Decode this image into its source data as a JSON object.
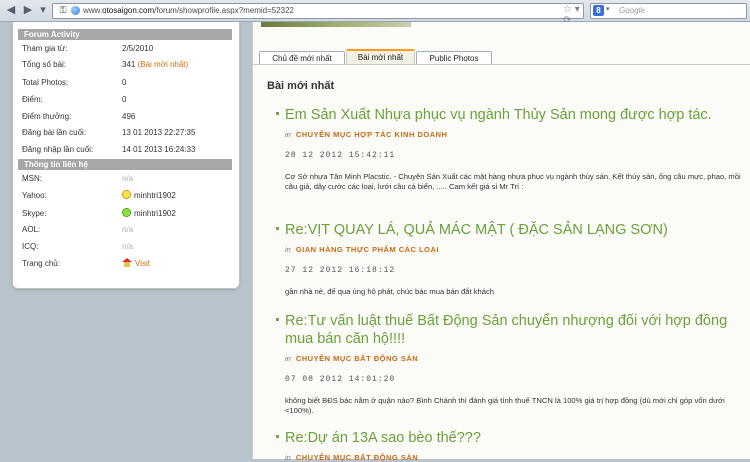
{
  "browser": {
    "url_prefix": "www.",
    "url_domain": "otosaigon.com",
    "url_path": "/forum/showprofile.aspx?memid=52322",
    "search_placeholder": "Google",
    "search_engine_letter": "8"
  },
  "sidebar": {
    "activity_header": "Forum Activity",
    "activity_rows": [
      {
        "label": "Tham gia từ:",
        "value": "2/5/2010"
      },
      {
        "label": "Tổng số bài:",
        "value": "341",
        "link": "(Bài mới nhất)"
      },
      {
        "label": "Total Photos:",
        "value": "0"
      },
      {
        "label": "Điểm:",
        "value": "0"
      },
      {
        "label": "Điểm thưởng:",
        "value": "496"
      },
      {
        "label": "Đăng bài lần cuối:",
        "value": "13 01 2013 22:27:35"
      },
      {
        "label": "Đăng nhập lần cuối:",
        "value": "14 01 2013 16:24:33"
      }
    ],
    "contact_header": "Thông tin liên hệ",
    "contact_rows": [
      {
        "label": "MSN:",
        "value": "n/a"
      },
      {
        "label": "Yahoo:",
        "value": "minhtri1902"
      },
      {
        "label": "Skype:",
        "value": "minhtri1902"
      },
      {
        "label": "AOL:",
        "value": "n/a"
      },
      {
        "label": "ICQ:",
        "value": "n/a"
      },
      {
        "label": "Trang chủ:",
        "value": "Visit"
      }
    ]
  },
  "tabs": [
    {
      "label": "Chủ đề mới nhất"
    },
    {
      "label": "Bài mới nhất"
    },
    {
      "label": "Public Photos"
    }
  ],
  "section_title": "Bài mới nhất",
  "posts": [
    {
      "title": "Em Sản Xuất Nhựa phục vụ ngành Thủy Sản mong được hợp tác.",
      "in": "in",
      "category": "CHUYÊN MỤC HỢP TÁC KINH DOANH",
      "date": "28 12 2012 15:42:11",
      "body": "Cơ Sở nhựa Tân Minh Placstic. - Chuyên Sản Xuất các mặt hàng nhựa phục vụ ngành thủy sản. Kết thúy sản, ống câu mực, phao, mồi câu giả, dây cước các loại, lưới câu cá biển, ..... Cam kết giá sỉ Mr Trí :"
    },
    {
      "title": "Re:VỊT QUAY LÁ, QUẢ MÁC MẬT ( ĐẶC SẢN LẠNG SƠN)",
      "in": "in",
      "category": "GIAN HÀNG THỰC PHẨM CÁC LOẠI",
      "date": "27 12 2012 16:18:12",
      "body": "gần nhà nè, để qua ủng hộ phát, chúc bác mua bán đắt khách"
    },
    {
      "title": "Re:Tư vấn luật thuế Bất Động Sản chuyển nhượng đối với hợp đồng mua bán căn hộ!!!!",
      "in": "in",
      "category": "CHUYÊN MỤC BẤT ĐỘNG SẢN",
      "date": "07 08 2012 14:01:20",
      "body": "không biết BĐS bác nằm ở quận nào? Bình Chánh thì đánh giá tính thuế TNCN là 100% giá trị hợp đồng (dù mới chỉ góp vốn dưới <100%)."
    },
    {
      "title": "Re:Dự án 13A sao bèo thế???",
      "in": "in",
      "category": "CHUYÊN MỤC BẤT ĐỘNG SẢN",
      "date": "",
      "body": ""
    }
  ]
}
